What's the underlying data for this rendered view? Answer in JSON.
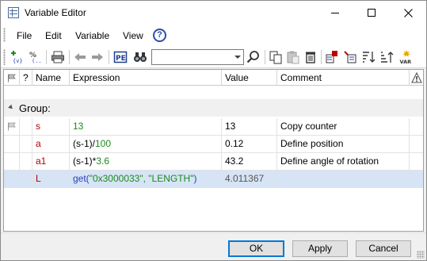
{
  "window": {
    "title": "Variable Editor"
  },
  "menu": [
    "File",
    "Edit",
    "Variable",
    "View"
  ],
  "toolbar": {
    "search_value": "",
    "icons": [
      "add-variable-icon",
      "add-expression-icon",
      "print-icon",
      "undo-icon",
      "redo-icon",
      "properties-icon",
      "find-icon",
      "search-go-icon",
      "copy-icon",
      "paste-icon",
      "delete-icon",
      "export-icon",
      "import-icon",
      "sort-descending-icon",
      "sort-ascending-icon",
      "variable-manager-icon"
    ]
  },
  "columns": {
    "question": "?",
    "name": "Name",
    "expression": "Expression",
    "value": "Value",
    "comment": "Comment"
  },
  "group": {
    "label": "Group:"
  },
  "rows": [
    {
      "name": "s",
      "expression": {
        "fn": "",
        "parts": [
          {
            "t": "13",
            "k": "num"
          }
        ]
      },
      "value": "13",
      "comment": "Copy counter"
    },
    {
      "name": "a",
      "expression": {
        "parts": [
          {
            "t": "(s-1)/",
            "k": "op"
          },
          {
            "t": "100",
            "k": "num"
          }
        ]
      },
      "value": "0.12",
      "comment": "Define position"
    },
    {
      "name": "a1",
      "expression": {
        "parts": [
          {
            "t": "(s-1)*",
            "k": "op"
          },
          {
            "t": "3.6",
            "k": "num"
          }
        ]
      },
      "value": "43.2",
      "comment": "Define angle of rotation"
    },
    {
      "name": "L",
      "expression": {
        "parts": [
          {
            "t": "get(",
            "k": "fn"
          },
          {
            "t": "\"0x3000033\", \"LENGTH\"",
            "k": "str"
          },
          {
            "t": ")",
            "k": "fn"
          }
        ]
      },
      "value": "4.011367",
      "comment": ""
    }
  ],
  "buttons": {
    "ok": "OK",
    "apply": "Apply",
    "cancel": "Cancel"
  },
  "colors": {
    "name": "#b00000",
    "number": "#1b8a1b",
    "function": "#2a3fb5",
    "selected_row": "#d6e4f5",
    "ok_border": "#0078d7"
  }
}
